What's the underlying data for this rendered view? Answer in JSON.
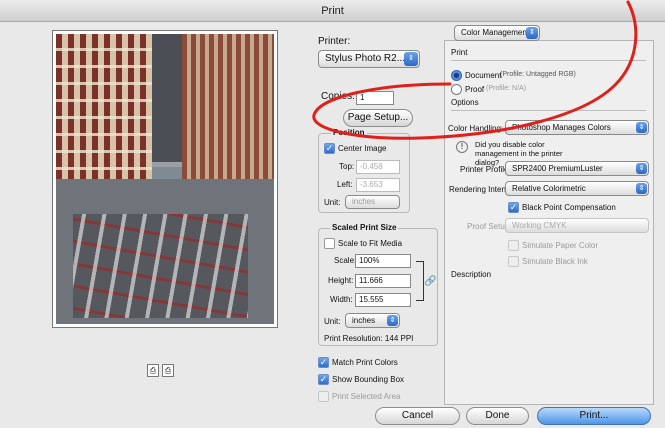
{
  "window": {
    "title": "Print"
  },
  "printer": {
    "label": "Printer:",
    "value": "Stylus Photo R2..."
  },
  "copies": {
    "label": "Copies:",
    "value": "1"
  },
  "page_setup": {
    "label": "Page Setup..."
  },
  "position": {
    "title": "Position",
    "center_image": "Center Image",
    "top_label": "Top:",
    "top_value": "-0.458",
    "left_label": "Left:",
    "left_value": "-3.653",
    "unit_label": "Unit:",
    "unit_value": "inches"
  },
  "scaled_print": {
    "title": "Scaled Print Size",
    "scale_to_fit": "Scale to Fit Media",
    "scale_label": "Scale:",
    "scale_value": "100%",
    "height_label": "Height:",
    "height_value": "11.666",
    "width_label": "Width:",
    "width_value": "15.555",
    "unit_label": "Unit:",
    "unit_value": "inches",
    "resolution": "Print Resolution: 144 PPI"
  },
  "options_left": {
    "match_print_colors": "Match Print Colors",
    "show_bounding_box": "Show Bounding Box",
    "print_selected_area": "Print Selected Area"
  },
  "color_mgmt": {
    "popup": "Color Management",
    "print_label": "Print",
    "document_label": "Document",
    "document_profile": "(Profile: Untagged RGB)",
    "proof_label": "Proof",
    "proof_profile": "(Profile: N/A)",
    "options_label": "Options",
    "color_handling_label": "Color Handling:",
    "color_handling_value": "Photoshop Manages Colors",
    "notice": "Did you disable color management in the printer dialog?",
    "printer_profile_label": "Printer Profile:",
    "printer_profile_value": "SPR2400 PremiumLuster",
    "rendering_intent_label": "Rendering Intent:",
    "rendering_intent_value": "Relative Colorimetric",
    "black_point": "Black Point Compensation",
    "proof_setup_label": "Proof Setup:",
    "proof_setup_value": "Working CMYK",
    "simulate_paper": "Simulate Paper Color",
    "simulate_black": "Simulate Black Ink",
    "description_label": "Description"
  },
  "buttons": {
    "cancel": "Cancel",
    "done": "Done",
    "print": "Print..."
  },
  "annotation": {
    "color": "#e0201a"
  }
}
